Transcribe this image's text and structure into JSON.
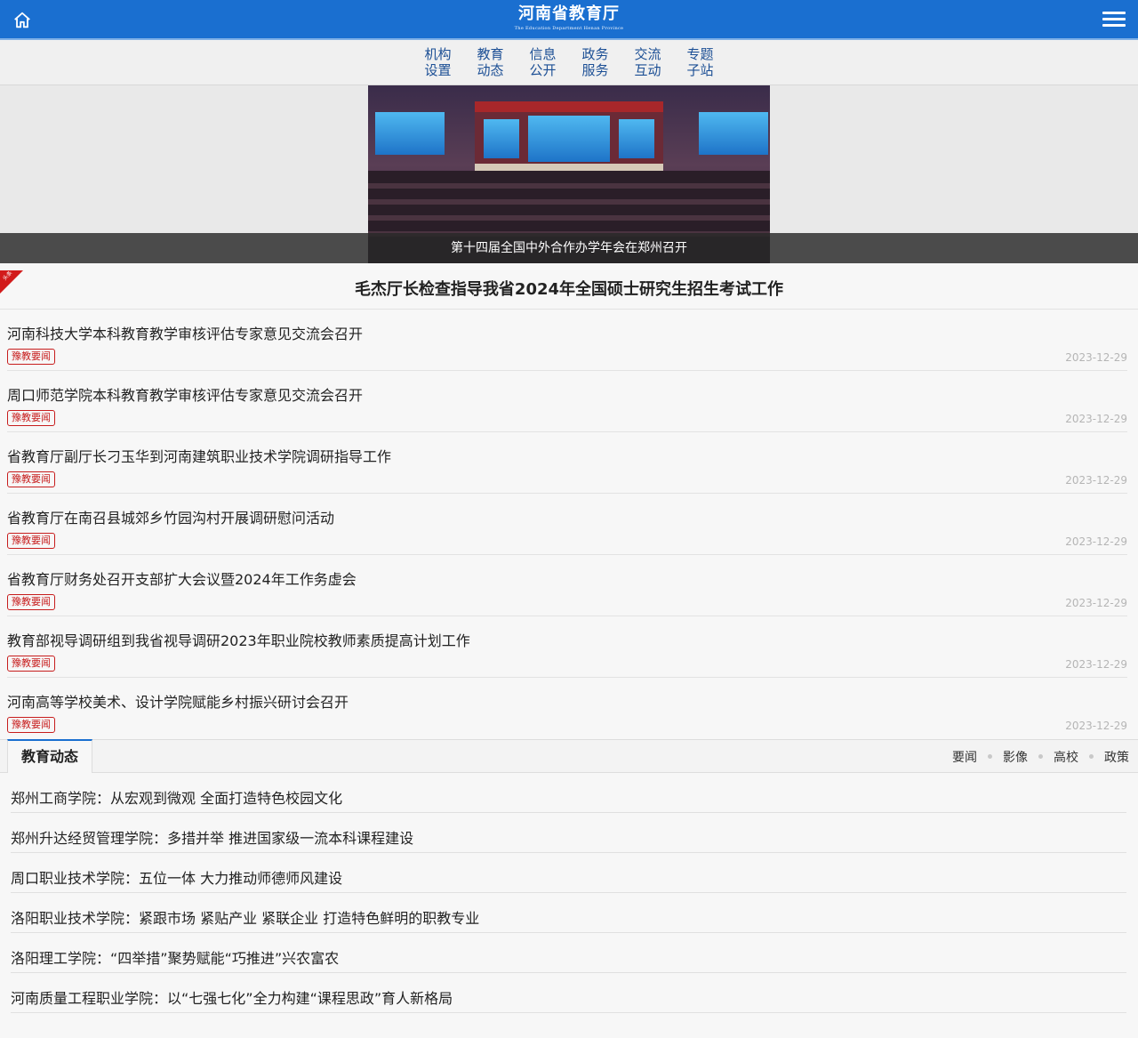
{
  "header": {
    "logo_main": "河南省教育厅",
    "logo_sub": "The Education Department Henan Province"
  },
  "nav": {
    "items": [
      {
        "l1": "机构",
        "l2": "设置"
      },
      {
        "l1": "教育",
        "l2": "动态"
      },
      {
        "l1": "信息",
        "l2": "公开"
      },
      {
        "l1": "政务",
        "l2": "服务"
      },
      {
        "l1": "交流",
        "l2": "互动"
      },
      {
        "l1": "专题",
        "l2": "子站"
      }
    ]
  },
  "banner": {
    "caption": "第十四届全国中外合作办学年会在郑州召开"
  },
  "headline": {
    "ribbon": "头条",
    "title": "毛杰厅长检查指导我省2024年全国硕士研究生招生考试工作"
  },
  "news": [
    {
      "title": "河南科技大学本科教育教学审核评估专家意见交流会召开",
      "tag": "豫教要闻",
      "date": "2023-12-29"
    },
    {
      "title": "周口师范学院本科教育教学审核评估专家意见交流会召开",
      "tag": "豫教要闻",
      "date": "2023-12-29"
    },
    {
      "title": "省教育厅副厅长刁玉华到河南建筑职业技术学院调研指导工作",
      "tag": "豫教要闻",
      "date": "2023-12-29"
    },
    {
      "title": "省教育厅在南召县城郊乡竹园沟村开展调研慰问活动",
      "tag": "豫教要闻",
      "date": "2023-12-29"
    },
    {
      "title": "省教育厅财务处召开支部扩大会议暨2024年工作务虚会",
      "tag": "豫教要闻",
      "date": "2023-12-29"
    },
    {
      "title": "教育部视导调研组到我省视导调研2023年职业院校教师素质提高计划工作",
      "tag": "豫教要闻",
      "date": "2023-12-29"
    },
    {
      "title": "河南高等学校美术、设计学院赋能乡村振兴研讨会召开",
      "tag": "豫教要闻",
      "date": "2023-12-29"
    }
  ],
  "section": {
    "tab": "教育动态",
    "links": [
      "要闻",
      "影像",
      "高校",
      "政策"
    ]
  },
  "dynamics": [
    "郑州工商学院：从宏观到微观 全面打造特色校园文化",
    "郑州升达经贸管理学院：多措并举 推进国家级一流本科课程建设",
    "周口职业技术学院：五位一体 大力推动师德师风建设",
    "洛阳职业技术学院：紧跟市场 紧贴产业 紧联企业 打造特色鲜明的职教专业",
    "洛阳理工学院：“四举措”聚势赋能“巧推进”兴农富农",
    "河南质量工程职业学院：以“七强七化”全力构建“课程思政”育人新格局"
  ],
  "colors": {
    "header_blue": "#1a6fd0",
    "nav_text": "#1c4f95",
    "tag_red": "#c71d1d"
  }
}
